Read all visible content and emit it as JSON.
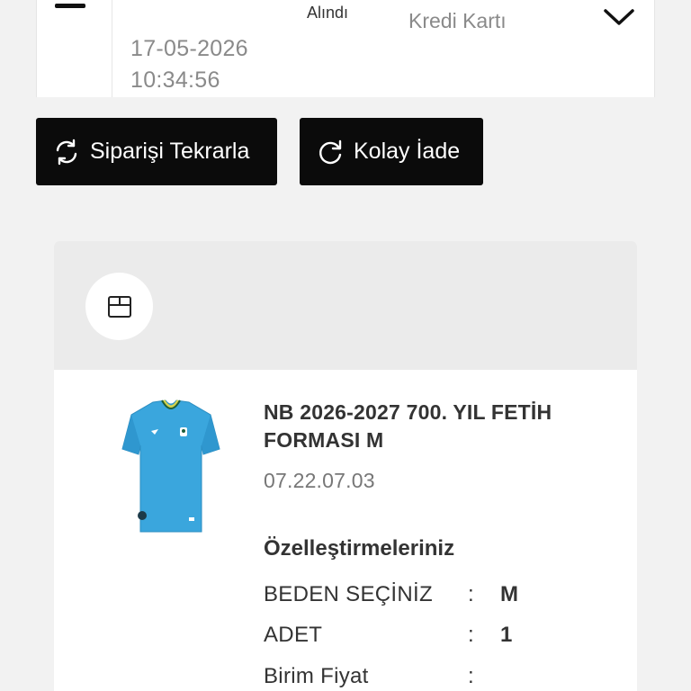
{
  "order": {
    "status": "Alındı",
    "date": "17-05-2026",
    "time": "10:34:56",
    "payment_method": "Kredi Kartı"
  },
  "actions": {
    "reorder_label": "Siparişi Tekrarla",
    "return_label": "Kolay İade"
  },
  "product": {
    "title": "NB 2026-2027 700. YIL FETİH FORMASI M",
    "code": "07.22.07.03",
    "customizations_heading": "Özelleştirmeleriniz",
    "attributes": [
      {
        "label": "BEDEN SEÇİNİZ",
        "separator": ":",
        "value": "M"
      },
      {
        "label": "ADET",
        "separator": ":",
        "value": "1"
      },
      {
        "label": "Birim Fiyat",
        "separator": ":",
        "value": ""
      }
    ]
  },
  "icons": {
    "collapse": "minus-icon",
    "expand": "chevron-down-icon",
    "reorder": "refresh-icon",
    "return": "return-icon",
    "package": "box-icon"
  },
  "colors": {
    "button_bg": "#0b0b0b",
    "button_text": "#ffffff",
    "muted_text": "#8a8a8a",
    "jersey": "#3aa6dd"
  }
}
